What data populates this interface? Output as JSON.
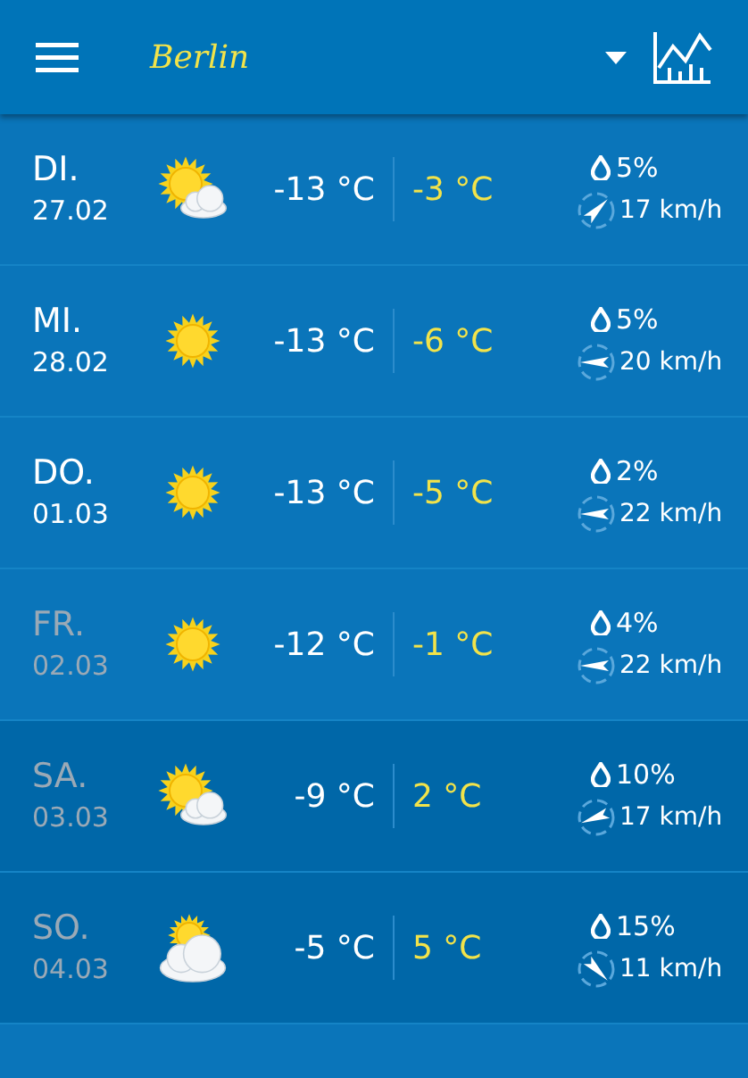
{
  "header": {
    "city": "Berlin"
  },
  "days": [
    {
      "day": "DI.",
      "date": "27.02",
      "dimmed": false,
      "weekend": false,
      "kind": "sun-cloud",
      "low": "-13 °C",
      "high": "-3 °C",
      "rain": "5%",
      "wind": "17 km/h"
    },
    {
      "day": "MI.",
      "date": "28.02",
      "dimmed": false,
      "weekend": false,
      "kind": "sun",
      "low": "-13 °C",
      "high": "-6 °C",
      "rain": "5%",
      "wind": "20 km/h"
    },
    {
      "day": "DO.",
      "date": "01.03",
      "dimmed": false,
      "weekend": false,
      "kind": "sun",
      "low": "-13 °C",
      "high": "-5 °C",
      "rain": "2%",
      "wind": "22 km/h"
    },
    {
      "day": "FR.",
      "date": "02.03",
      "dimmed": true,
      "weekend": false,
      "kind": "sun",
      "low": "-12 °C",
      "high": "-1 °C",
      "rain": "4%",
      "wind": "22 km/h"
    },
    {
      "day": "SA.",
      "date": "03.03",
      "dimmed": true,
      "weekend": true,
      "kind": "sun-cloud",
      "low": "-9 °C",
      "high": "2 °C",
      "rain": "10%",
      "wind": "17 km/h"
    },
    {
      "day": "SO.",
      "date": "04.03",
      "dimmed": true,
      "weekend": true,
      "kind": "cloud-sun",
      "low": "-5 °C",
      "high": "5 °C",
      "rain": "15%",
      "wind": "11 km/h"
    }
  ]
}
